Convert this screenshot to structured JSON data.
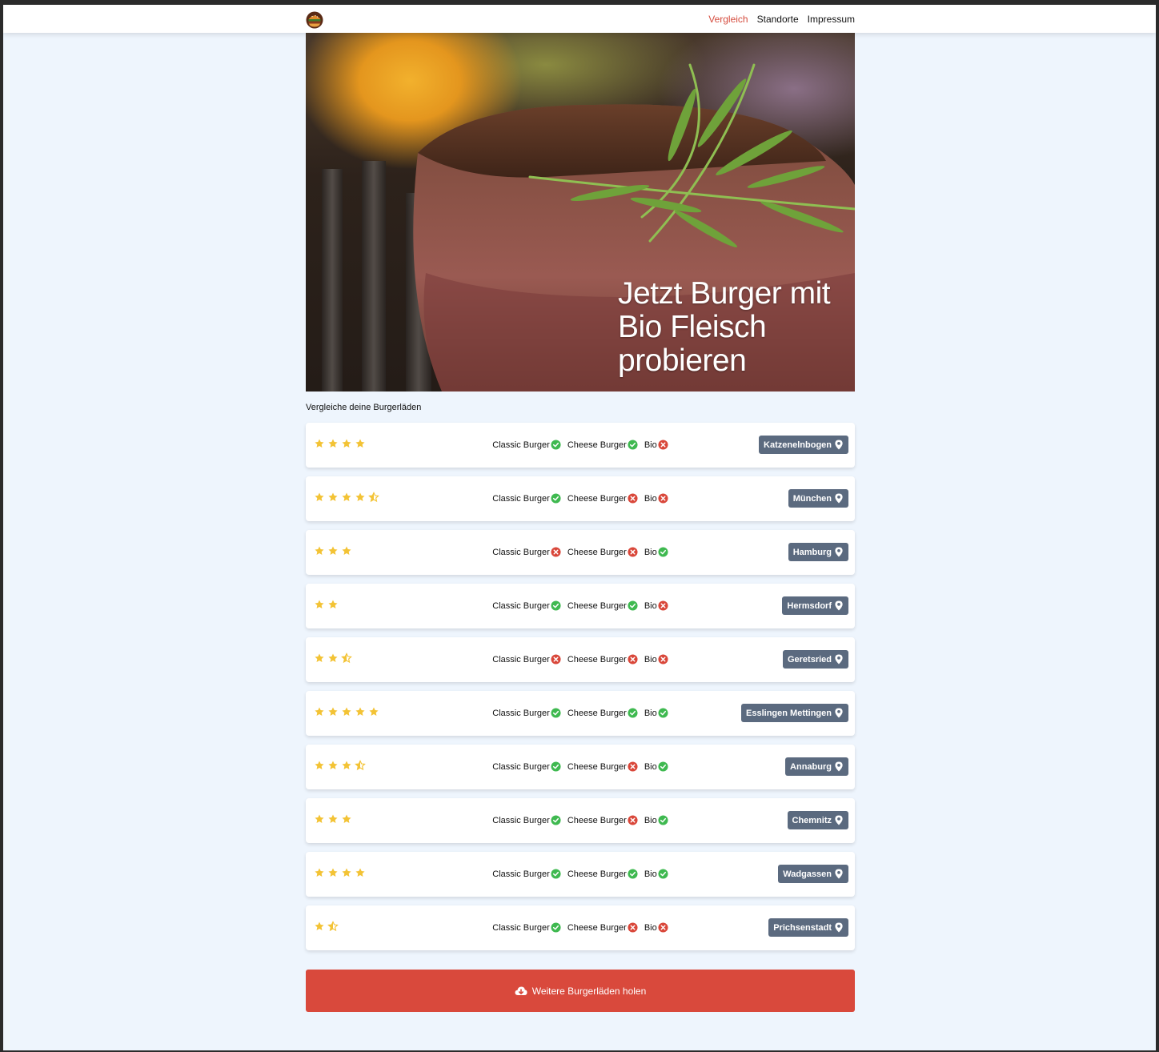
{
  "nav": {
    "links": [
      {
        "label": "Vergleich",
        "active": true
      },
      {
        "label": "Standorte",
        "active": false
      },
      {
        "label": "Impressum",
        "active": false
      }
    ],
    "logo_icon": "burger-logo-icon"
  },
  "hero": {
    "title": "Jetzt Burger mit Bio Fleisch probieren",
    "image": "grilled-steak-with-rosemary"
  },
  "subtitle": "Vergleiche deine Burgerläden",
  "colors": {
    "accent": "#d9493c",
    "nav_active": "#d54b3d",
    "star": "#f3c335",
    "check": "#3fb950",
    "cross": "#d9473a",
    "badge": "#5b6a7f"
  },
  "shops": [
    {
      "rating": 4,
      "features": [
        {
          "label": "Classic Burger",
          "ok": true
        },
        {
          "label": "Cheese Burger",
          "ok": true
        },
        {
          "label": "Bio",
          "ok": false
        }
      ],
      "location": "Katzenelnbogen"
    },
    {
      "rating": 4.5,
      "features": [
        {
          "label": "Classic Burger",
          "ok": true
        },
        {
          "label": "Cheese Burger",
          "ok": false
        },
        {
          "label": "Bio",
          "ok": false
        }
      ],
      "location": "München"
    },
    {
      "rating": 3,
      "features": [
        {
          "label": "Classic Burger",
          "ok": false
        },
        {
          "label": "Cheese Burger",
          "ok": false
        },
        {
          "label": "Bio",
          "ok": true
        }
      ],
      "location": "Hamburg"
    },
    {
      "rating": 2,
      "features": [
        {
          "label": "Classic Burger",
          "ok": true
        },
        {
          "label": "Cheese Burger",
          "ok": true
        },
        {
          "label": "Bio",
          "ok": false
        }
      ],
      "location": "Hermsdorf"
    },
    {
      "rating": 2.5,
      "features": [
        {
          "label": "Classic Burger",
          "ok": false
        },
        {
          "label": "Cheese Burger",
          "ok": false
        },
        {
          "label": "Bio",
          "ok": false
        }
      ],
      "location": "Geretsried"
    },
    {
      "rating": 5,
      "features": [
        {
          "label": "Classic Burger",
          "ok": true
        },
        {
          "label": "Cheese Burger",
          "ok": true
        },
        {
          "label": "Bio",
          "ok": true
        }
      ],
      "location": "Esslingen Mettingen"
    },
    {
      "rating": 3.5,
      "features": [
        {
          "label": "Classic Burger",
          "ok": true
        },
        {
          "label": "Cheese Burger",
          "ok": false
        },
        {
          "label": "Bio",
          "ok": true
        }
      ],
      "location": "Annaburg"
    },
    {
      "rating": 3,
      "features": [
        {
          "label": "Classic Burger",
          "ok": true
        },
        {
          "label": "Cheese Burger",
          "ok": false
        },
        {
          "label": "Bio",
          "ok": true
        }
      ],
      "location": "Chemnitz"
    },
    {
      "rating": 4,
      "features": [
        {
          "label": "Classic Burger",
          "ok": true
        },
        {
          "label": "Cheese Burger",
          "ok": true
        },
        {
          "label": "Bio",
          "ok": true
        }
      ],
      "location": "Wadgassen"
    },
    {
      "rating": 1.5,
      "features": [
        {
          "label": "Classic Burger",
          "ok": true
        },
        {
          "label": "Cheese Burger",
          "ok": false
        },
        {
          "label": "Bio",
          "ok": false
        }
      ],
      "location": "Prichsenstadt"
    }
  ],
  "more_button": {
    "label": "Weitere Burgerläden holen",
    "icon": "cloud-download-icon"
  }
}
